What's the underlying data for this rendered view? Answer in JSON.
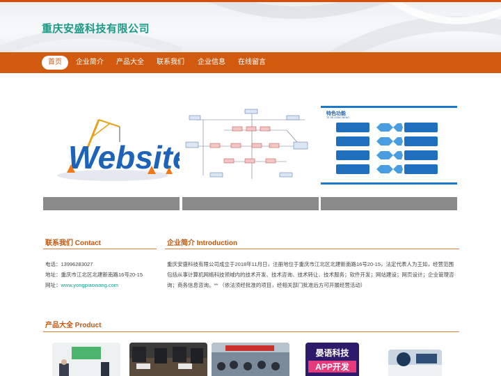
{
  "site": {
    "title": "重庆安盛科技有限公司"
  },
  "nav": {
    "items": [
      {
        "label": "首页",
        "active": true
      },
      {
        "label": "企业简介",
        "active": false
      },
      {
        "label": "产品大全",
        "active": false
      },
      {
        "label": "联系我们",
        "active": false
      },
      {
        "label": "企业信息",
        "active": false
      },
      {
        "label": "在线留言",
        "active": false
      }
    ]
  },
  "banners": {
    "website": {
      "text": "Website"
    },
    "feature": {
      "title": "特色功能",
      "subtitle": "TE SE GONG NENG"
    }
  },
  "contact": {
    "title": "联系我们 Contact",
    "phone_label": "电话：",
    "phone": "13996283027",
    "address_label": "地址：",
    "address": "重庆市江北区北建新南路16号20-15",
    "website_label": "网址：",
    "website": "www.yongpiaowang.com"
  },
  "intro": {
    "title": "企业简介 Introduction",
    "text": "重庆安盛科技有限公司成立于2018年11月日，注册地位于重庆市江北区北建新南路16号20-15，法定代表人为王如，经营范围包括从事计算机网络科技领域内的技术开发、技术咨询、技术转让、技术服务；软件开发；网站建设；网页设计；企业管理咨询；商务信息咨询。** （依法须经批准的项目，经相关部门批准后方可开展经营活动）"
  },
  "products": {
    "title": "产品大全 Product",
    "thumb4_line1": "晏语科技",
    "thumb4_line2": "APP开发"
  },
  "colors": {
    "brand_orange": "#d25a0f",
    "brand_teal": "#1a9a86",
    "caption_gray": "#8a8a8a"
  }
}
